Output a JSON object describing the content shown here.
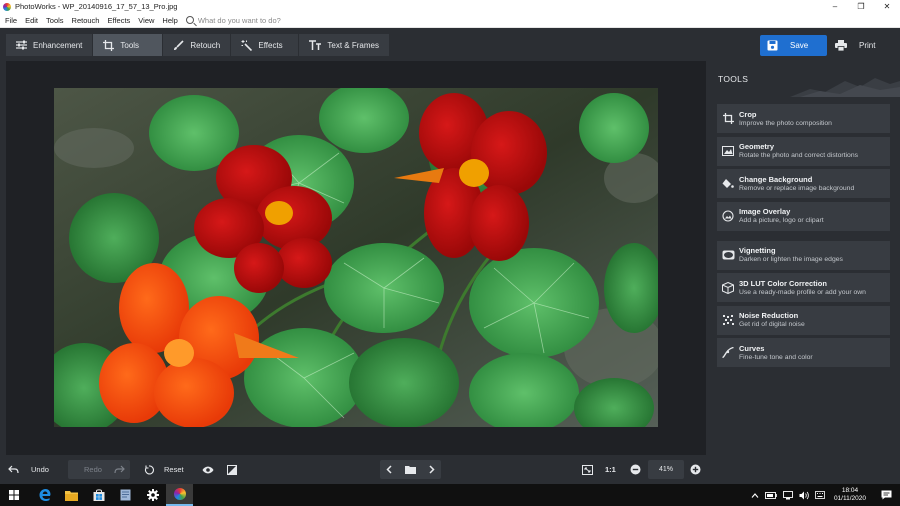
{
  "window": {
    "title": "PhotoWorks - WP_20140916_17_57_13_Pro.jpg",
    "minimize": "–",
    "maximize": "❐",
    "close": "✕"
  },
  "menu": {
    "items": [
      "File",
      "Edit",
      "Tools",
      "Retouch",
      "Effects",
      "View",
      "Help"
    ],
    "search_placeholder": "What do you want to do?"
  },
  "toolbar": {
    "tabs": [
      {
        "label": "Enhancement",
        "icon": "sliders-icon",
        "active": false
      },
      {
        "label": "Tools",
        "icon": "crop-icon",
        "active": true
      },
      {
        "label": "Retouch",
        "icon": "brush-icon",
        "active": false
      },
      {
        "label": "Effects",
        "icon": "magic-wand-icon",
        "active": false
      },
      {
        "label": "Text & Frames",
        "icon": "text-icon",
        "active": false
      }
    ],
    "save_label": "Save",
    "print_label": "Print"
  },
  "panel": {
    "title": "TOOLS",
    "tools": [
      {
        "name": "Crop",
        "desc": "Improve the photo composition",
        "icon": "crop-icon"
      },
      {
        "name": "Geometry",
        "desc": "Rotate the photo and correct distortions",
        "icon": "geometry-icon"
      },
      {
        "name": "Change Background",
        "desc": "Remove or replace image background",
        "icon": "paint-bucket-icon"
      },
      {
        "name": "Image Overlay",
        "desc": "Add a picture, logo or clipart",
        "icon": "overlay-icon"
      },
      {
        "name": "Vignetting",
        "desc": "Darken or lighten the image edges",
        "icon": "vignette-icon"
      },
      {
        "name": "3D LUT Color Correction",
        "desc": "Use a ready-made profile or add your own",
        "icon": "cube-icon"
      },
      {
        "name": "Noise Reduction",
        "desc": "Get rid of digital noise",
        "icon": "noise-icon"
      },
      {
        "name": "Curves",
        "desc": "Fine-tune tone and color",
        "icon": "curves-icon"
      }
    ]
  },
  "bottombar": {
    "undo_label": "Undo",
    "redo_label": "Redo",
    "reset_label": "Reset",
    "ratio_label": "1:1",
    "zoom_value": "41%"
  },
  "taskbar": {
    "time": "18:04",
    "date": "01/11/2020"
  },
  "colors": {
    "accent": "#1f6fd0",
    "app_bg": "#2b2e33",
    "canvas_bg": "#1f2125",
    "tool_bg": "#383c42"
  }
}
